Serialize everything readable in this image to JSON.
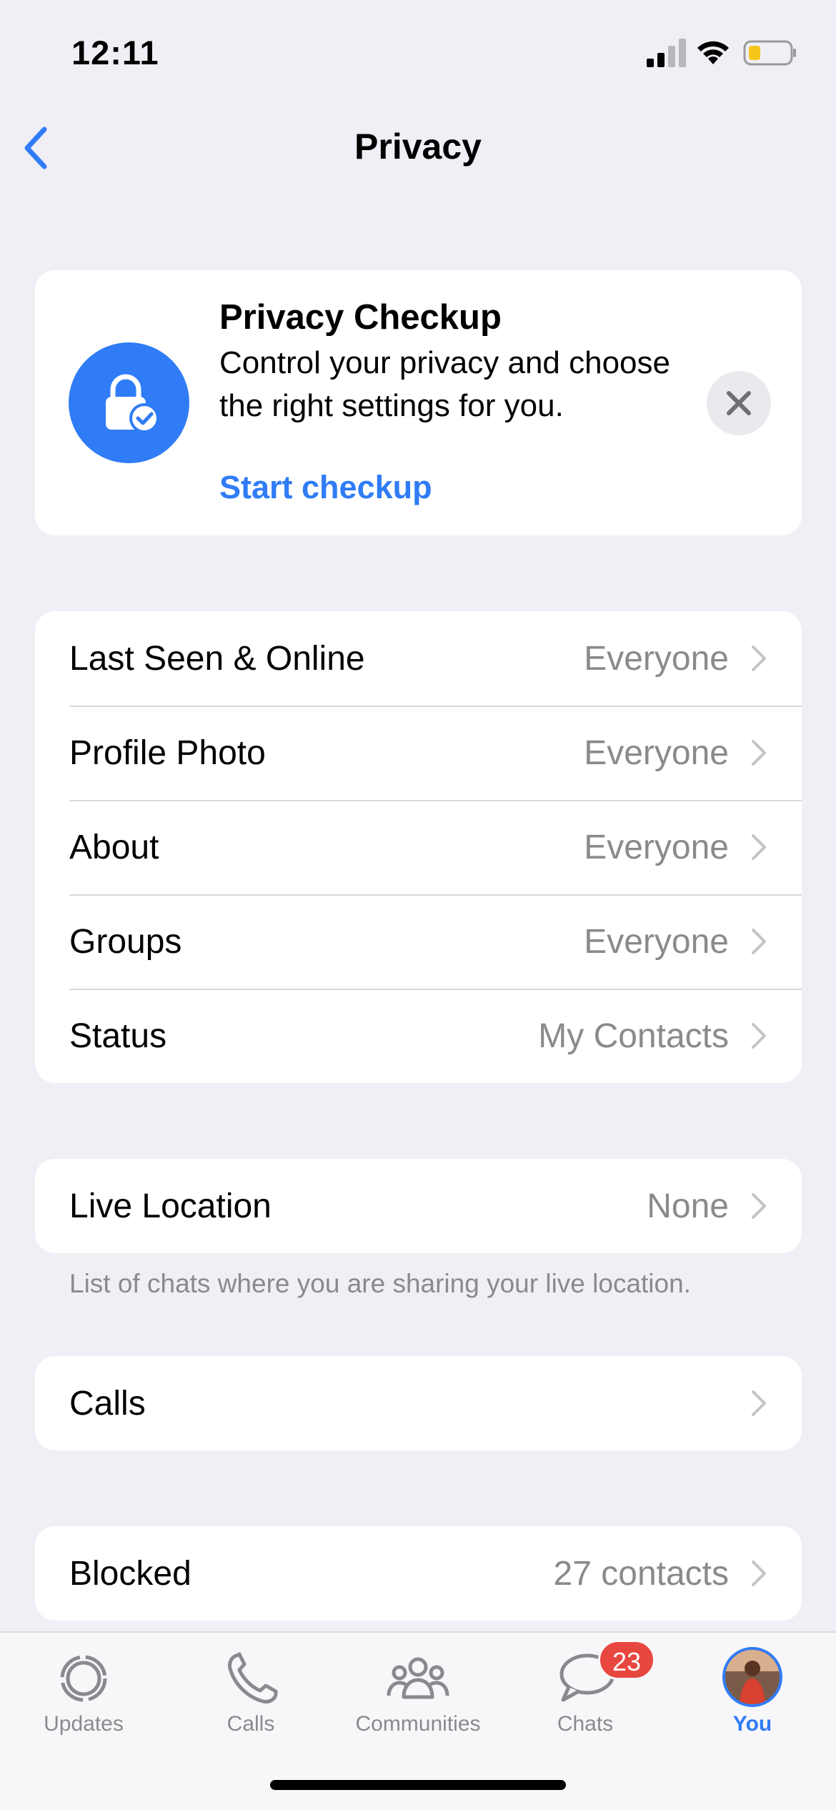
{
  "status_bar": {
    "time": "12:11"
  },
  "nav": {
    "title": "Privacy",
    "back_icon": "chevron-left-icon"
  },
  "privacy_checkup": {
    "title": "Privacy Checkup",
    "description": "Control your privacy and choose the right settings for you.",
    "link": "Start checkup",
    "icon": "lock-check-icon",
    "close_icon": "close-icon"
  },
  "visibility_settings": [
    {
      "label": "Last Seen & Online",
      "value": "Everyone"
    },
    {
      "label": "Profile Photo",
      "value": "Everyone"
    },
    {
      "label": "About",
      "value": "Everyone"
    },
    {
      "label": "Groups",
      "value": "Everyone"
    },
    {
      "label": "Status",
      "value": "My Contacts"
    }
  ],
  "live_location": {
    "label": "Live Location",
    "value": "None",
    "footnote": "List of chats where you are sharing your live location."
  },
  "calls": {
    "label": "Calls"
  },
  "blocked": {
    "label": "Blocked",
    "value": "27 contacts"
  },
  "tab_bar": {
    "tabs": [
      {
        "label": "Updates",
        "icon": "updates-icon"
      },
      {
        "label": "Calls",
        "icon": "phone-icon"
      },
      {
        "label": "Communities",
        "icon": "communities-icon"
      },
      {
        "label": "Chats",
        "icon": "chats-icon",
        "badge": "23"
      },
      {
        "label": "You",
        "icon": "avatar",
        "active": true
      }
    ]
  },
  "colors": {
    "accent": "#2f7cf6",
    "background": "#f0eff5",
    "secondary_text": "#8a8a8e",
    "badge": "#e8473f"
  }
}
